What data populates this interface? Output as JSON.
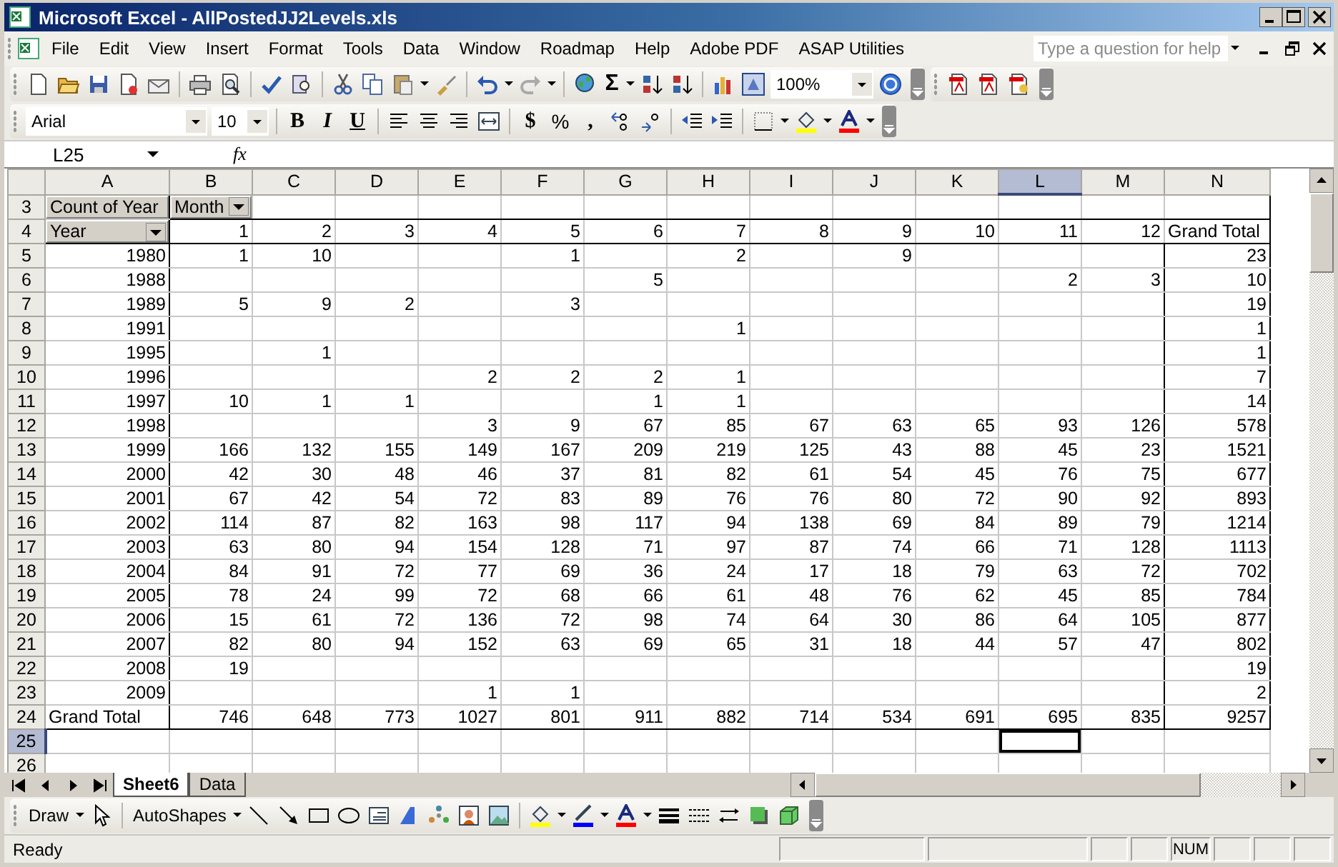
{
  "window": {
    "title": "Microsoft Excel - AllPostedJJ2Levels.xls"
  },
  "menu": [
    "File",
    "Edit",
    "View",
    "Insert",
    "Format",
    "Tools",
    "Data",
    "Window",
    "Roadmap",
    "Help",
    "Adobe PDF",
    "ASAP Utilities"
  ],
  "help_search": {
    "placeholder": "Type a question for help"
  },
  "standard_toolbar": {
    "sum_symbol": "Σ",
    "zoom": "100%"
  },
  "formatting_toolbar": {
    "font": "Arial",
    "size": "10",
    "bold": "B",
    "italic": "I",
    "underline": "U",
    "currency": "$",
    "percent": "%",
    "comma": ","
  },
  "formula_bar": {
    "name_box": "L25",
    "fx": "fx"
  },
  "sheet": {
    "columns": [
      {
        "label": "A",
        "selected": false
      },
      {
        "label": "B",
        "selected": false
      },
      {
        "label": "C",
        "selected": false
      },
      {
        "label": "D",
        "selected": false
      },
      {
        "label": "E",
        "selected": false
      },
      {
        "label": "F",
        "selected": false
      },
      {
        "label": "G",
        "selected": false
      },
      {
        "label": "H",
        "selected": false
      },
      {
        "label": "I",
        "selected": false
      },
      {
        "label": "J",
        "selected": false
      },
      {
        "label": "K",
        "selected": false
      },
      {
        "label": "L",
        "selected": true
      },
      {
        "label": "M",
        "selected": false
      },
      {
        "label": "N",
        "selected": false
      }
    ],
    "rows": [
      {
        "label": "3",
        "selected": false,
        "kind": "fields",
        "cells": [
          "Count of Year",
          "Month"
        ]
      },
      {
        "label": "4",
        "selected": false,
        "kind": "header",
        "cells": [
          "Year",
          "1",
          "2",
          "3",
          "4",
          "5",
          "6",
          "7",
          "8",
          "9",
          "10",
          "11",
          "12",
          "Grand Total"
        ]
      },
      {
        "label": "5",
        "selected": false,
        "kind": "data",
        "cells": [
          "1980",
          "1",
          "10",
          null,
          null,
          "1",
          null,
          "2",
          null,
          "9",
          null,
          null,
          null,
          "23"
        ]
      },
      {
        "label": "6",
        "selected": false,
        "kind": "data",
        "cells": [
          "1988",
          null,
          null,
          null,
          null,
          null,
          "5",
          null,
          null,
          null,
          null,
          "2",
          "3",
          "10"
        ]
      },
      {
        "label": "7",
        "selected": false,
        "kind": "data",
        "cells": [
          "1989",
          "5",
          "9",
          "2",
          null,
          "3",
          null,
          null,
          null,
          null,
          null,
          null,
          null,
          "19"
        ]
      },
      {
        "label": "8",
        "selected": false,
        "kind": "data",
        "cells": [
          "1991",
          null,
          null,
          null,
          null,
          null,
          null,
          "1",
          null,
          null,
          null,
          null,
          null,
          "1"
        ]
      },
      {
        "label": "9",
        "selected": false,
        "kind": "data",
        "cells": [
          "1995",
          null,
          "1",
          null,
          null,
          null,
          null,
          null,
          null,
          null,
          null,
          null,
          null,
          "1"
        ]
      },
      {
        "label": "10",
        "selected": false,
        "kind": "data",
        "cells": [
          "1996",
          null,
          null,
          null,
          "2",
          "2",
          "2",
          "1",
          null,
          null,
          null,
          null,
          null,
          "7"
        ]
      },
      {
        "label": "11",
        "selected": false,
        "kind": "data",
        "cells": [
          "1997",
          "10",
          "1",
          "1",
          null,
          null,
          "1",
          "1",
          null,
          null,
          null,
          null,
          null,
          "14"
        ]
      },
      {
        "label": "12",
        "selected": false,
        "kind": "data",
        "cells": [
          "1998",
          null,
          null,
          null,
          "3",
          "9",
          "67",
          "85",
          "67",
          "63",
          "65",
          "93",
          "126",
          "578"
        ]
      },
      {
        "label": "13",
        "selected": false,
        "kind": "data",
        "cells": [
          "1999",
          "166",
          "132",
          "155",
          "149",
          "167",
          "209",
          "219",
          "125",
          "43",
          "88",
          "45",
          "23",
          "1521"
        ]
      },
      {
        "label": "14",
        "selected": false,
        "kind": "data",
        "cells": [
          "2000",
          "42",
          "30",
          "48",
          "46",
          "37",
          "81",
          "82",
          "61",
          "54",
          "45",
          "76",
          "75",
          "677"
        ]
      },
      {
        "label": "15",
        "selected": false,
        "kind": "data",
        "cells": [
          "2001",
          "67",
          "42",
          "54",
          "72",
          "83",
          "89",
          "76",
          "76",
          "80",
          "72",
          "90",
          "92",
          "893"
        ]
      },
      {
        "label": "16",
        "selected": false,
        "kind": "data",
        "cells": [
          "2002",
          "114",
          "87",
          "82",
          "163",
          "98",
          "117",
          "94",
          "138",
          "69",
          "84",
          "89",
          "79",
          "1214"
        ]
      },
      {
        "label": "17",
        "selected": false,
        "kind": "data",
        "cells": [
          "2003",
          "63",
          "80",
          "94",
          "154",
          "128",
          "71",
          "97",
          "87",
          "74",
          "66",
          "71",
          "128",
          "1113"
        ]
      },
      {
        "label": "18",
        "selected": false,
        "kind": "data",
        "cells": [
          "2004",
          "84",
          "91",
          "72",
          "77",
          "69",
          "36",
          "24",
          "17",
          "18",
          "79",
          "63",
          "72",
          "702"
        ]
      },
      {
        "label": "19",
        "selected": false,
        "kind": "data",
        "cells": [
          "2005",
          "78",
          "24",
          "99",
          "72",
          "68",
          "66",
          "61",
          "48",
          "76",
          "62",
          "45",
          "85",
          "784"
        ]
      },
      {
        "label": "20",
        "selected": false,
        "kind": "data",
        "cells": [
          "2006",
          "15",
          "61",
          "72",
          "136",
          "72",
          "98",
          "74",
          "64",
          "30",
          "86",
          "64",
          "105",
          "877"
        ]
      },
      {
        "label": "21",
        "selected": false,
        "kind": "data",
        "cells": [
          "2007",
          "82",
          "80",
          "94",
          "152",
          "63",
          "69",
          "65",
          "31",
          "18",
          "44",
          "57",
          "47",
          "802"
        ]
      },
      {
        "label": "22",
        "selected": false,
        "kind": "data",
        "cells": [
          "2008",
          "19",
          null,
          null,
          null,
          null,
          null,
          null,
          null,
          null,
          null,
          null,
          null,
          "19"
        ]
      },
      {
        "label": "23",
        "selected": false,
        "kind": "data",
        "cells": [
          "2009",
          null,
          null,
          null,
          "1",
          "1",
          null,
          null,
          null,
          null,
          null,
          null,
          null,
          "2"
        ]
      },
      {
        "label": "24",
        "selected": false,
        "kind": "total",
        "cells": [
          "Grand Total",
          "746",
          "648",
          "773",
          "1027",
          "801",
          "911",
          "882",
          "714",
          "534",
          "691",
          "695",
          "835",
          "9257"
        ]
      },
      {
        "label": "25",
        "selected": true,
        "kind": "blank"
      },
      {
        "label": "26",
        "selected": false,
        "kind": "blank"
      }
    ]
  },
  "sheet_tabs": [
    {
      "label": "Sheet6",
      "selected": true
    },
    {
      "label": "Data",
      "selected": false
    }
  ],
  "drawing_toolbar": {
    "draw": "Draw",
    "autoshapes": "AutoShapes"
  },
  "status_bar": {
    "status": "Ready",
    "num_lock": "NUM"
  }
}
